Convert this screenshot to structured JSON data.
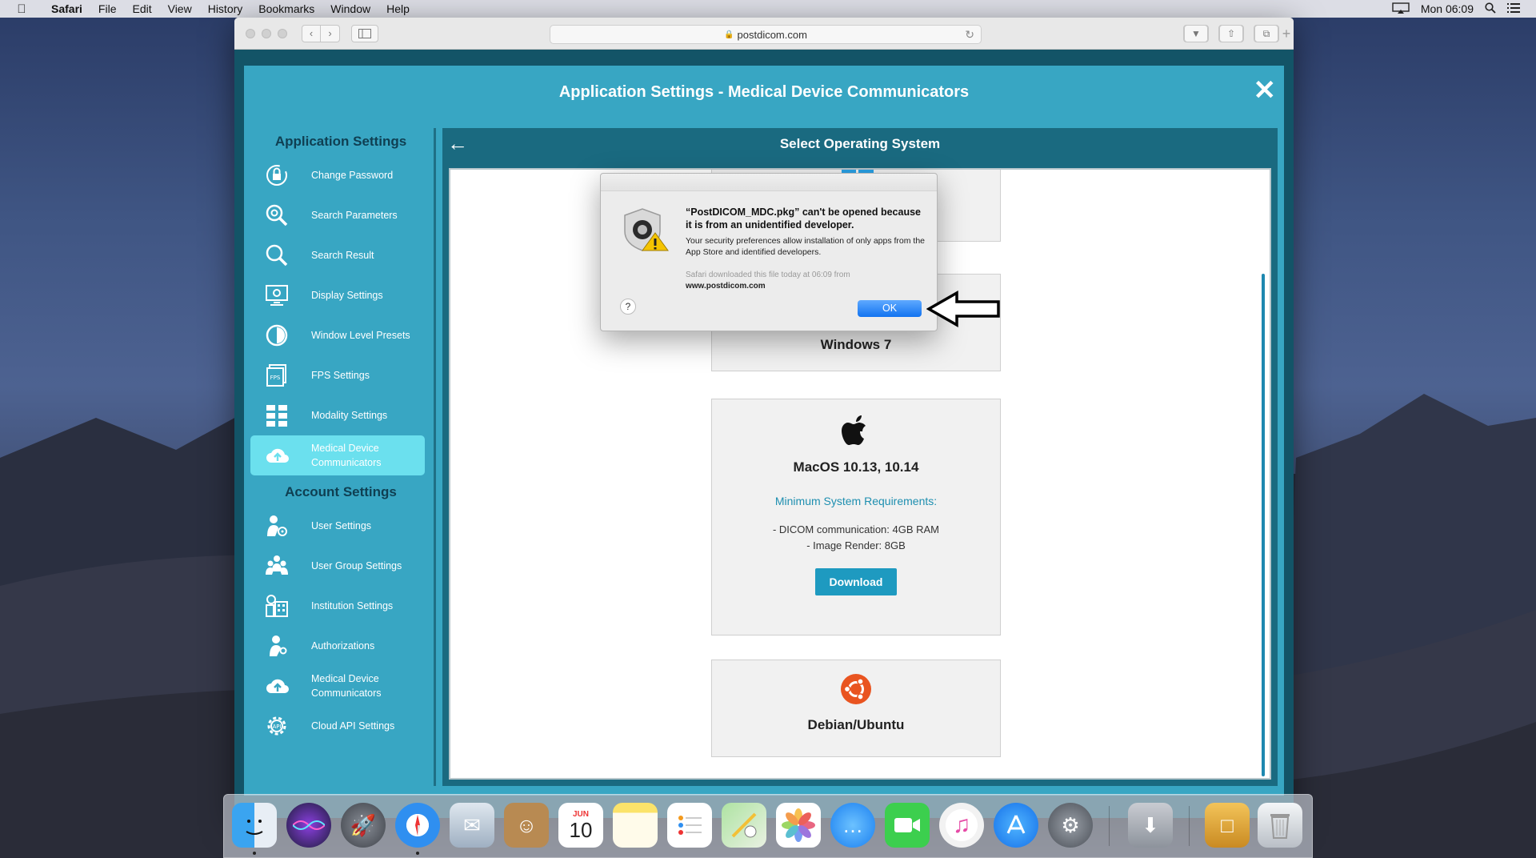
{
  "menubar": {
    "app_name": "Safari",
    "items": [
      "File",
      "Edit",
      "View",
      "History",
      "Bookmarks",
      "Window",
      "Help"
    ],
    "clock": "Mon 06:09"
  },
  "browser": {
    "url": "postdicom.com"
  },
  "modal": {
    "title": "Application Settings - Medical Device Communicators",
    "close_symbol": "✕"
  },
  "sidebar": {
    "app_settings_title": "Application Settings",
    "app_items": [
      {
        "label": "Change Password",
        "icon": "lock-icon"
      },
      {
        "label": "Search Parameters",
        "icon": "search-gear-icon"
      },
      {
        "label": "Search Result",
        "icon": "search-icon"
      },
      {
        "label": "Display Settings",
        "icon": "monitor-icon"
      },
      {
        "label": "Window Level Presets",
        "icon": "contrast-icon"
      },
      {
        "label": "FPS Settings",
        "icon": "fps-icon"
      },
      {
        "label": "Modality Settings",
        "icon": "grid-icon"
      },
      {
        "label": "Medical Device Communicators",
        "icon": "cloud-upload-icon"
      }
    ],
    "account_settings_title": "Account Settings",
    "account_items": [
      {
        "label": "User Settings",
        "icon": "user-gear-icon"
      },
      {
        "label": "User Group Settings",
        "icon": "user-group-icon"
      },
      {
        "label": "Institution Settings",
        "icon": "institution-icon"
      },
      {
        "label": "Authorizations",
        "icon": "key-user-icon"
      },
      {
        "label": "Medical Device Communicators",
        "icon": "cloud-upload-icon"
      },
      {
        "label": "Cloud API Settings",
        "icon": "api-gear-icon"
      }
    ]
  },
  "content": {
    "header": "Select Operating System",
    "windows_partial_label": "Windows 7",
    "mac_card": {
      "name": "MacOS 10.13, 10.14",
      "req_title": "Minimum System Requirements:",
      "req_lines": [
        "- DICOM communication: 4GB RAM",
        "- Image Render: 8GB"
      ],
      "download_label": "Download"
    },
    "ubuntu_card": {
      "name": "Debian/Ubuntu"
    }
  },
  "alert": {
    "title": "“PostDICOM_MDC.pkg” can't be opened because it is from an unidentified developer.",
    "message": "Your security preferences allow installation of only apps from the App Store and identified developers.",
    "source_line": "Safari downloaded this file today at 06:09 from",
    "source_domain": "www.postdicom.com",
    "help_label": "?",
    "ok_label": "OK"
  },
  "dock": {
    "calendar_month": "JUN",
    "calendar_day": "10",
    "apps": [
      "Finder",
      "Siri",
      "Launchpad",
      "Safari",
      "Mail",
      "Contacts",
      "Calendar",
      "Notes",
      "Reminders",
      "Maps",
      "Photos",
      "Messages",
      "FaceTime",
      "iTunes",
      "App Store",
      "System Preferences",
      "Downloads",
      "Installer",
      "Trash"
    ]
  }
}
